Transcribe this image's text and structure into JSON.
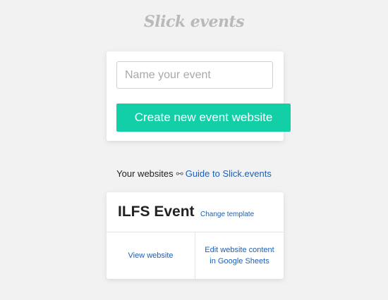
{
  "app": {
    "logo_text": "Slick events"
  },
  "create": {
    "input_value": "",
    "input_placeholder": "Name your event",
    "button_label": "Create new event website"
  },
  "websites": {
    "heading": "Your websites",
    "link_icon": "link-icon",
    "guide_link": "Guide to Slick.events",
    "items": [
      {
        "title": "ILFS Event",
        "change_template": "Change template",
        "view_label": "View website",
        "edit_label": "Edit website content in Google Sheets"
      }
    ]
  },
  "colors": {
    "background": "#f2f2f2",
    "accent": "#12cfa8",
    "link": "#1e5fb5",
    "logo": "#b9b9b9"
  }
}
